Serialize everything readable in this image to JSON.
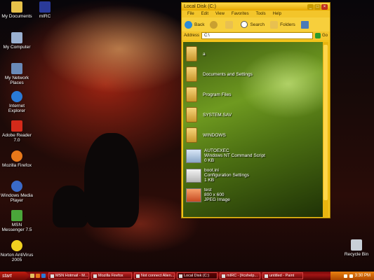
{
  "desktop": {
    "icons": [
      {
        "label": "My Documents",
        "icon": "folder-icon"
      },
      {
        "label": "mIRC",
        "icon": "mirc-icon"
      },
      {
        "label": "My Computer",
        "icon": "computer-icon"
      },
      {
        "label": "My Network Places",
        "icon": "network-icon"
      },
      {
        "label": "Internet Explorer",
        "icon": "ie-icon"
      },
      {
        "label": "Adobe Reader 7.0",
        "icon": "adobe-reader-icon"
      },
      {
        "label": "Mozilla Firefox",
        "icon": "firefox-icon"
      },
      {
        "label": "Windows Media Player",
        "icon": "media-player-icon"
      },
      {
        "label": "MSN Messenger 7.5",
        "icon": "msn-icon"
      },
      {
        "label": "Norton AntiVirus 2005",
        "icon": "norton-icon"
      },
      {
        "label": "Recycle Bin",
        "icon": "recycle-bin-icon"
      }
    ]
  },
  "window": {
    "title": "Local Disk (C:)",
    "menu": [
      "File",
      "Edit",
      "View",
      "Favorites",
      "Tools",
      "Help"
    ],
    "toolbar": {
      "back": "Back",
      "search": "Search",
      "folders": "Folders"
    },
    "address_label": "Address",
    "address_value": "C:\\",
    "go_label": "Go",
    "items": [
      {
        "name": "a",
        "type": "folder"
      },
      {
        "name": "Documents and Settings",
        "type": "folder"
      },
      {
        "name": "Program Files",
        "type": "folder"
      },
      {
        "name": "SYSTEM.SAV",
        "type": "folder"
      },
      {
        "name": "WINDOWS",
        "type": "folder"
      },
      {
        "name": "AUTOEXEC",
        "desc": "Windows NT Command Script",
        "size": "0 KB",
        "type": "cmd"
      },
      {
        "name": "boot.ini",
        "desc": "Configuration Settings",
        "size": "1 KB",
        "type": "sys"
      },
      {
        "name": "test",
        "desc": "800 x 600",
        "size": "JPEG Image",
        "type": "img"
      }
    ]
  },
  "taskbar": {
    "start_label": "start",
    "tasks": [
      {
        "label": "MSN Hotmail - M..."
      },
      {
        "label": "Mozilla Firefox"
      },
      {
        "label": "Not connect Alien..."
      },
      {
        "label": "Local Disk (C:)"
      },
      {
        "label": "mIRC - [#cshelp..."
      },
      {
        "label": "untitled - Paint"
      }
    ],
    "clock": "3:30 PM"
  },
  "colors": {
    "window_accent": "#f2c21a",
    "taskbar": "#a01414",
    "tray": "#e88010"
  }
}
